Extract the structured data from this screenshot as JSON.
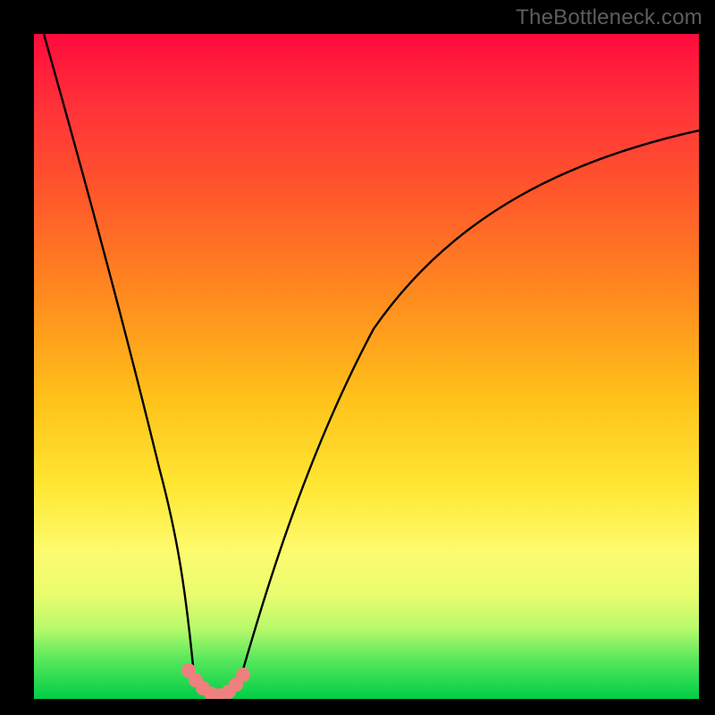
{
  "watermark": "TheBottleneck.com",
  "gradient_colors": {
    "top": "#ff0a3c",
    "upper_orange": "#ff8d1e",
    "mid_yellow": "#ffe733",
    "pale_yellow": "#fdfb6f",
    "light_green": "#b6f96b",
    "bottom": "#00cd47"
  },
  "curves": {
    "left_black": {
      "description": "steep black curve from top-left falling to valley near x≈0.27",
      "stroke": "#000000"
    },
    "right_black": {
      "description": "black curve rising from valley toward upper-right edge",
      "stroke": "#000000"
    },
    "pink_segment": {
      "description": "short salmon-pink segment at valley floor",
      "stroke": "#ef8080"
    }
  },
  "chart_data": {
    "type": "line",
    "title": "",
    "xlabel": "",
    "ylabel": "",
    "xlim": [
      0,
      1
    ],
    "ylim": [
      0,
      1
    ],
    "series": [
      {
        "name": "left-curve",
        "color": "#000000",
        "x": [
          0.015,
          0.03,
          0.05,
          0.07,
          0.09,
          0.11,
          0.13,
          0.15,
          0.17,
          0.19,
          0.21,
          0.225,
          0.242
        ],
        "y": [
          1.0,
          0.92,
          0.82,
          0.73,
          0.64,
          0.555,
          0.47,
          0.385,
          0.3,
          0.215,
          0.13,
          0.07,
          0.02
        ]
      },
      {
        "name": "right-curve",
        "color": "#000000",
        "x": [
          0.31,
          0.33,
          0.36,
          0.4,
          0.45,
          0.51,
          0.58,
          0.66,
          0.76,
          0.87,
          1.0
        ],
        "y": [
          0.03,
          0.085,
          0.175,
          0.285,
          0.4,
          0.5,
          0.59,
          0.67,
          0.74,
          0.8,
          0.855
        ]
      },
      {
        "name": "valley-pink",
        "color": "#ef8080",
        "x": [
          0.232,
          0.24,
          0.25,
          0.258,
          0.268,
          0.278,
          0.288,
          0.3,
          0.315
        ],
        "y": [
          0.042,
          0.028,
          0.014,
          0.006,
          0.003,
          0.003,
          0.008,
          0.018,
          0.034
        ]
      }
    ]
  }
}
